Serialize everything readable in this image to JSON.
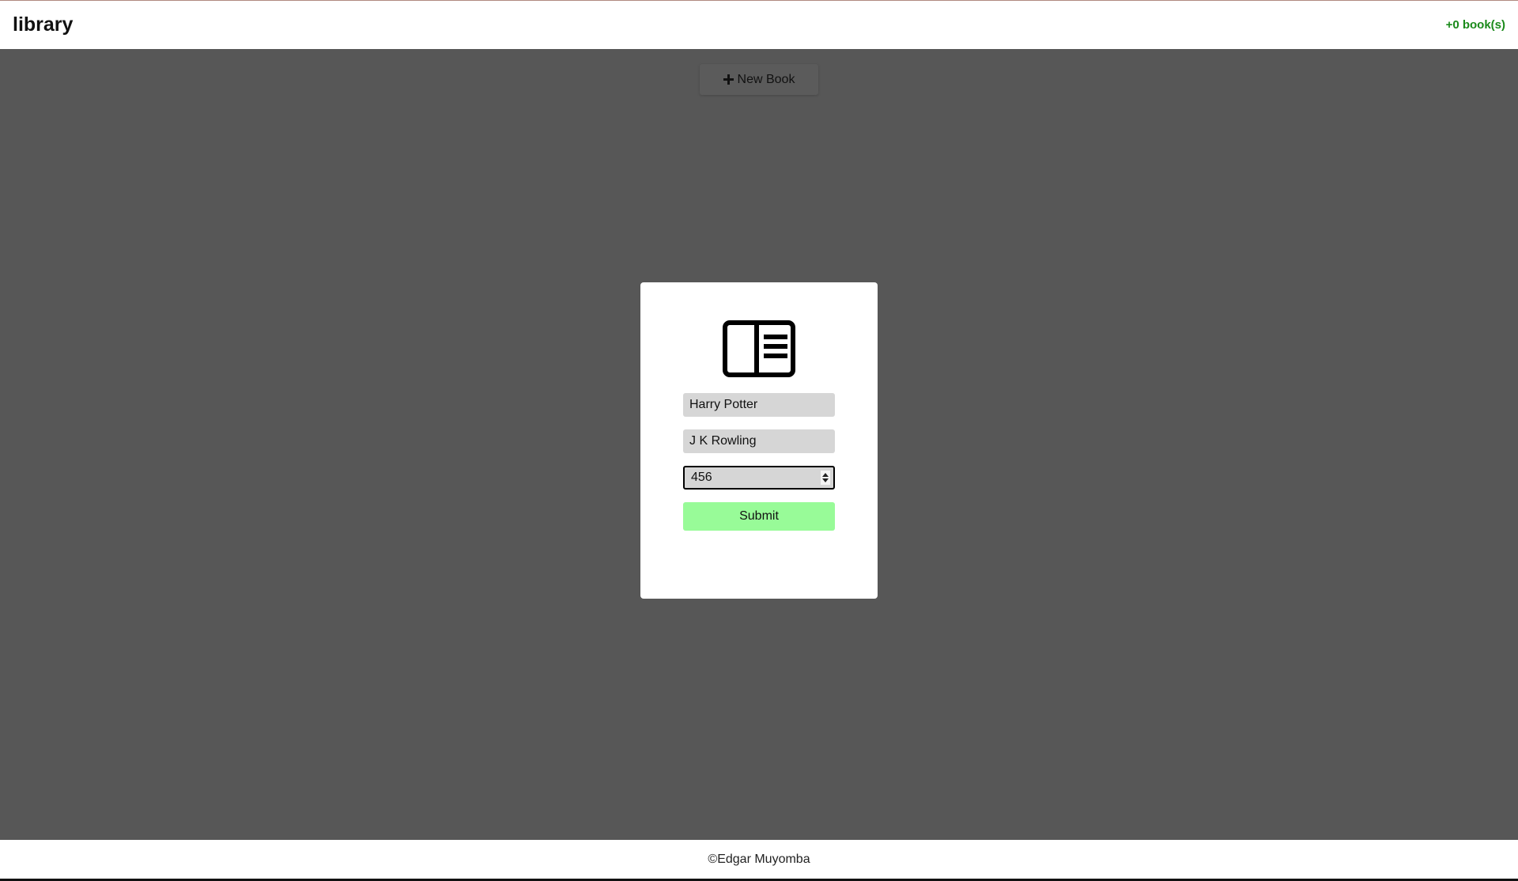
{
  "header": {
    "title": "library",
    "book_count": "+0 book(s)",
    "count_color": "#1a8a1a"
  },
  "toolbar": {
    "new_book_icon": "plus-icon",
    "new_book_label": "New Book"
  },
  "modal": {
    "icon": "book-icon",
    "title_value": "Harry Potter",
    "author_value": "J K Rowling",
    "pages_value": "456",
    "submit_label": "Submit",
    "submit_color": "#98fb98"
  },
  "footer": {
    "copyright": "©Edgar Muyomba"
  }
}
